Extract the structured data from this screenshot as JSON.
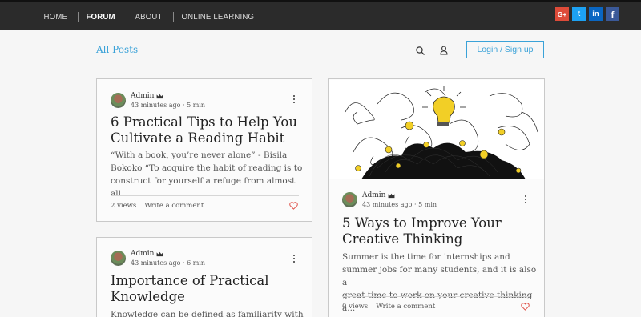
{
  "nav": {
    "items": [
      "HOME",
      "FORUM",
      "ABOUT",
      "ONLINE LEARNING"
    ],
    "active": "FORUM"
  },
  "social": {
    "google_plus": "G+",
    "twitter": "t",
    "linkedin": "in",
    "facebook": "f"
  },
  "header": {
    "all_posts": "All Posts",
    "login": "Login / Sign up"
  },
  "posts": [
    {
      "author": "Admin",
      "time": "43 minutes ago",
      "read": "5 min",
      "title_line1": "6 Practical Tips to Help You",
      "title_line2": "Cultivate a Reading Habit",
      "excerpt_line1": "“With a book, you’re never alone” - Bisila",
      "excerpt_line2": "Bokoko “To acquire the habit of reading is to",
      "excerpt_line3": "construct for yourself a refuge from almost all ...",
      "views": "2 views",
      "comment": "Write a comment"
    },
    {
      "author": "Admin",
      "time": "43 minutes ago",
      "read": "5 min",
      "title_line1": "5 Ways to Improve Your",
      "title_line2": "Creative Thinking",
      "excerpt_line1": "Summer is the time for internships and",
      "excerpt_line2": "summer jobs for many students, and it is also a",
      "excerpt_line3": "great time to work on your creative thinking a...",
      "views": "0 views",
      "comment": "Write a comment"
    },
    {
      "author": "Admin",
      "time": "43 minutes ago",
      "read": "6 min",
      "title_line1": "Importance of Practical",
      "title_line2": "Knowledge",
      "excerpt_line1": "Knowledge can be defined as familiarity with"
    }
  ],
  "colors": {
    "accent": "#3aa2d8",
    "topbar": "#2b2b2b",
    "heart": "#e0534a"
  }
}
